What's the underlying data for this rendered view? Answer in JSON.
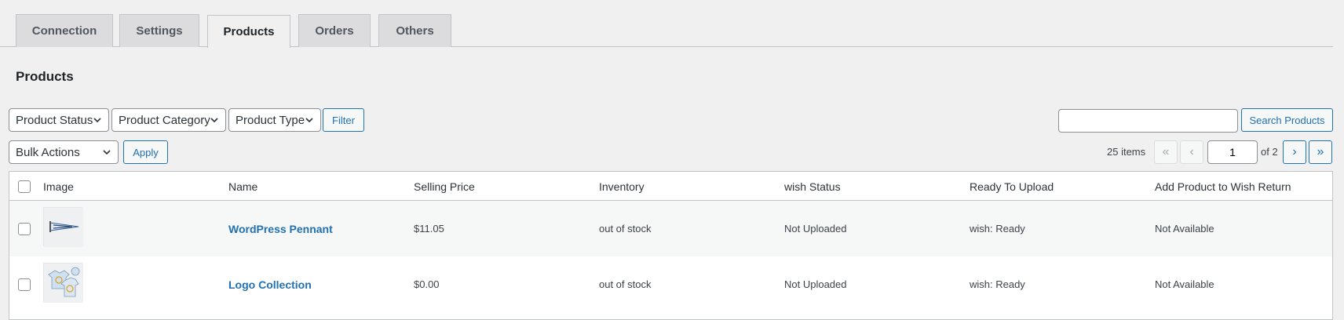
{
  "tabs": [
    {
      "label": "Connection"
    },
    {
      "label": "Settings"
    },
    {
      "label": "Products"
    },
    {
      "label": "Orders"
    },
    {
      "label": "Others"
    }
  ],
  "page": {
    "title": "Products"
  },
  "filters": {
    "product_status": "Product Status",
    "product_category": "Product Category",
    "product_type": "Product Type",
    "filter_button": "Filter"
  },
  "search": {
    "placeholder": "",
    "value": "",
    "button": "Search Products"
  },
  "bulk": {
    "selected": "Bulk Actions",
    "apply": "Apply"
  },
  "pagination": {
    "items": "25 items",
    "first": "«",
    "prev": "‹",
    "current_page": "1",
    "of_label": "of 2",
    "next": "›",
    "last": "»"
  },
  "table": {
    "columns": [
      "Image",
      "Name",
      "Selling Price",
      "Inventory",
      "wish Status",
      "Ready To Upload",
      "Add Product to Wish Return"
    ],
    "rows": [
      {
        "name": "WordPress Pennant",
        "price": "$11.05",
        "inventory": "out of stock",
        "wish_status": "Not Uploaded",
        "ready": "wish: Ready",
        "wish_return": "Not Available"
      },
      {
        "name": "Logo Collection",
        "price": "$0.00",
        "inventory": "out of stock",
        "wish_status": "Not Uploaded",
        "ready": "wish: Ready",
        "wish_return": "Not Available"
      }
    ]
  },
  "colors": {
    "accent": "#2271b1",
    "background": "#f0f0f1",
    "border": "#c3c4c7"
  }
}
